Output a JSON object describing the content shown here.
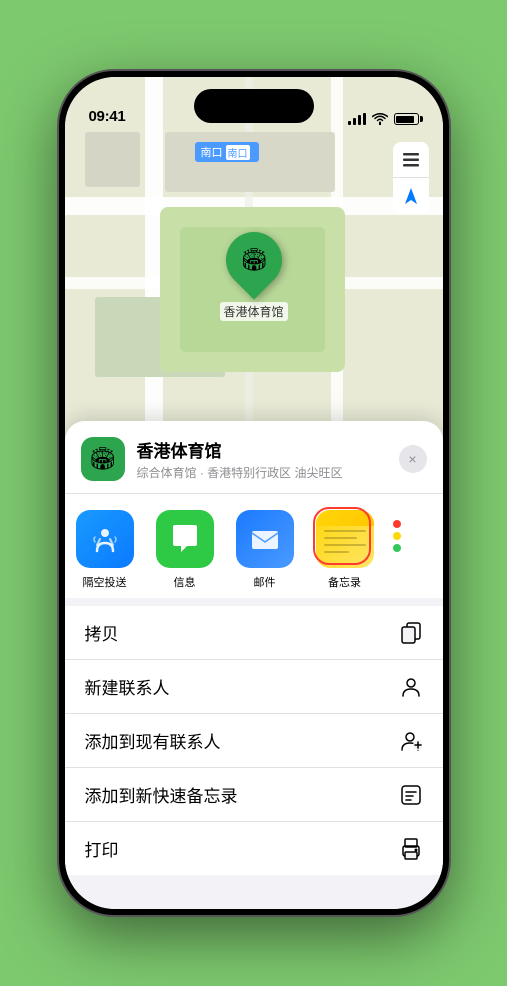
{
  "status_bar": {
    "time": "09:41",
    "signal": "signal-icon",
    "wifi": "wifi-icon",
    "battery": "battery-icon"
  },
  "map": {
    "label": "南口",
    "location_name": "香港体育馆",
    "controls": {
      "layers_icon": "🗺",
      "location_icon": "⬆"
    }
  },
  "venue": {
    "name": "香港体育馆",
    "subtitle": "综合体育馆 · 香港特别行政区 油尖旺区",
    "close_label": "×"
  },
  "share_apps": [
    {
      "id": "airdrop",
      "label": "隔空投送"
    },
    {
      "id": "messages",
      "label": "信息"
    },
    {
      "id": "mail",
      "label": "邮件"
    },
    {
      "id": "notes",
      "label": "备忘录"
    },
    {
      "id": "more",
      "label": ""
    }
  ],
  "actions": [
    {
      "label": "拷贝",
      "icon": "copy"
    },
    {
      "label": "新建联系人",
      "icon": "person"
    },
    {
      "label": "添加到现有联系人",
      "icon": "add-person"
    },
    {
      "label": "添加到新快速备忘录",
      "icon": "note"
    },
    {
      "label": "打印",
      "icon": "print"
    }
  ]
}
